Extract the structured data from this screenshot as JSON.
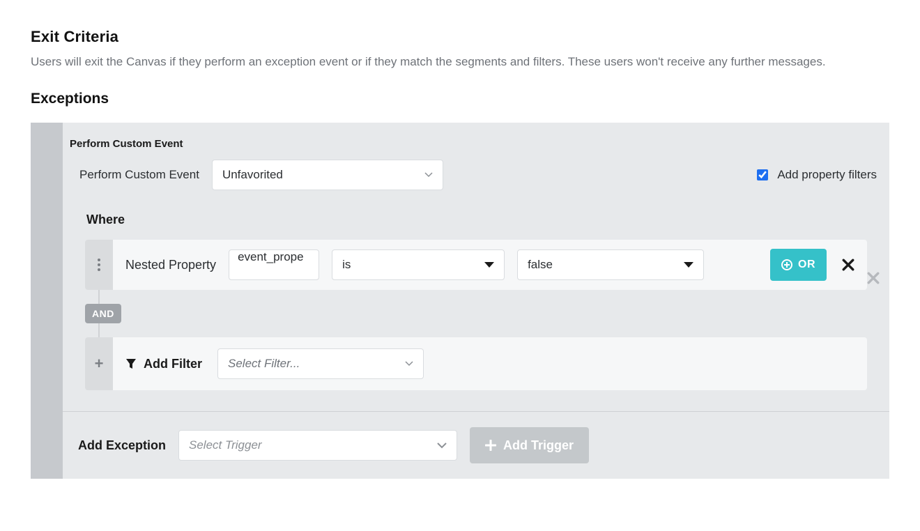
{
  "header": {
    "title": "Exit Criteria",
    "description": "Users will exit the Canvas if they perform an exception event or if they match the segments and filters. These users won't receive any further messages."
  },
  "exceptions": {
    "title": "Exceptions",
    "event": {
      "block_title": "Perform Custom Event",
      "label": "Perform Custom Event",
      "selected": "Unfavorited",
      "property_filters_label": "Add property filters",
      "property_filters_checked": true
    },
    "where_label": "Where",
    "filter_row": {
      "type_label": "Nested Property",
      "property_value": "event_prope",
      "operator": "is",
      "value": "false",
      "or_label": "OR"
    },
    "and_label": "AND",
    "add_filter": {
      "label": "Add Filter",
      "select_placeholder": "Select Filter..."
    },
    "footer": {
      "label": "Add Exception",
      "trigger_placeholder": "Select Trigger",
      "add_trigger_label": "Add Trigger"
    }
  }
}
